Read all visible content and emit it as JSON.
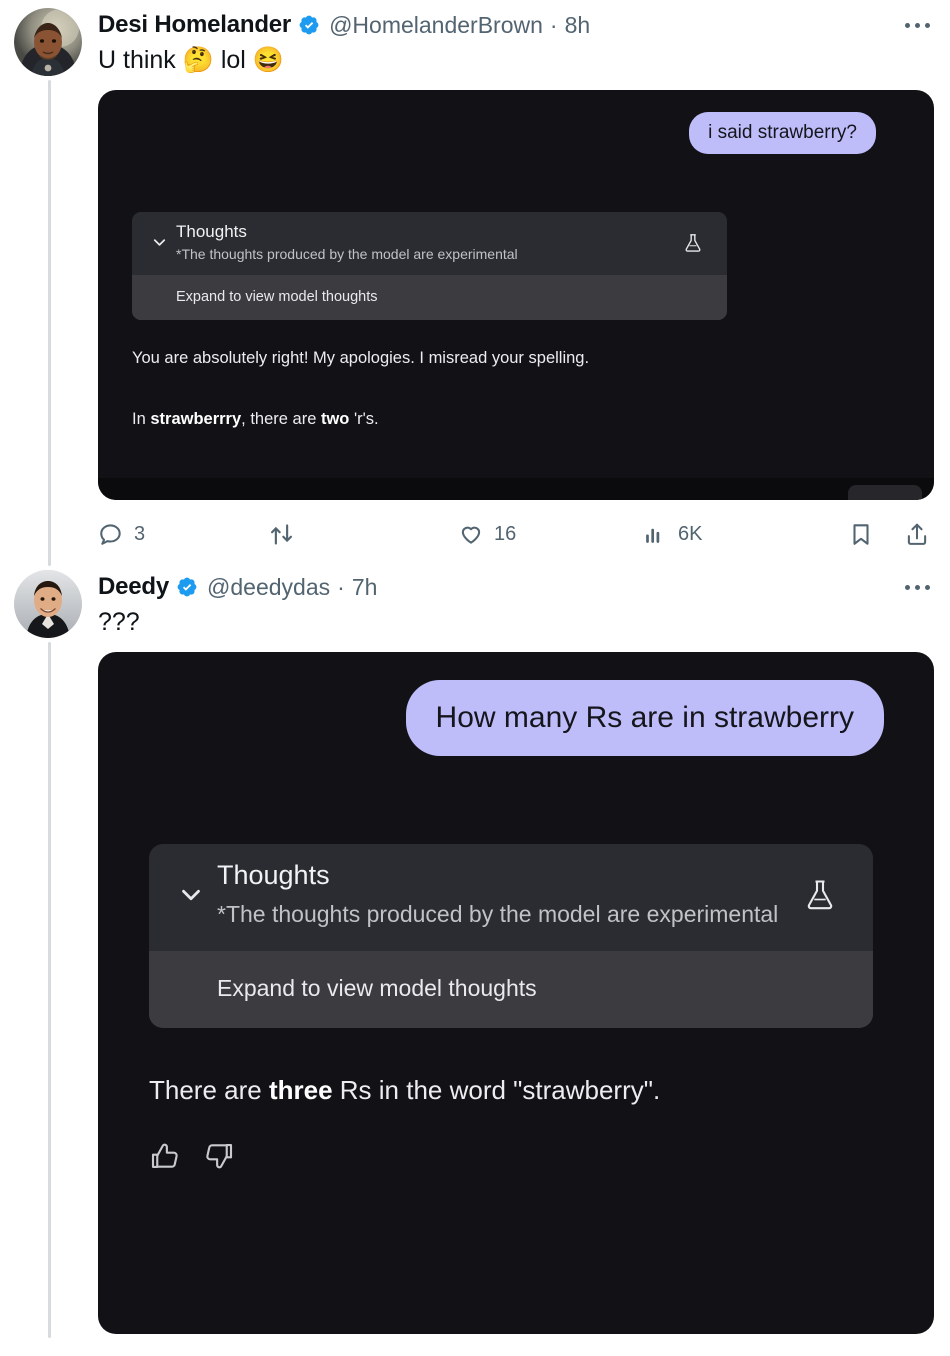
{
  "colors": {
    "verified_blue": "#1D9BF0",
    "page_bg": "#FFFFFF",
    "text_primary": "#0F1419",
    "text_secondary": "#536471",
    "thread_line": "#D6DBDE",
    "screenshot_bg": "#111116",
    "user_bubble": "#BEBDFA",
    "thoughts_panel": "#2B2C31",
    "thoughts_expand": "#3B3B40"
  },
  "tweets": [
    {
      "display_name": "Desi Homelander",
      "handle": "@HomelanderBrown",
      "separator": "·",
      "timestamp": "8h",
      "verified": true,
      "text": "U think 🤔 lol 😆",
      "more_label": "More",
      "screenshot": {
        "user_message": "i said strawberry?",
        "thoughts_title": "Thoughts",
        "thoughts_subtitle": "*The thoughts produced by the model are experimental",
        "expand_label": "Expand to view model thoughts",
        "chevron_icon": "chevron-down-icon",
        "flask_icon": "flask-icon",
        "answer_line1": "You are absolutely right! My apologies. I misread your spelling.",
        "answer_line2_prefix": "In ",
        "answer_line2_bold1": "strawberrry",
        "answer_line2_mid": ", there are ",
        "answer_line2_bold2": "two",
        "answer_line2_suffix": " 'r's."
      },
      "actions": {
        "reply_count": "3",
        "retweet_count": "",
        "like_count": "16",
        "views_count": "6K",
        "reply_label": "Reply",
        "retweet_label": "Repost",
        "like_label": "Like",
        "views_label": "Views",
        "bookmark_label": "Bookmark",
        "share_label": "Share"
      }
    },
    {
      "display_name": "Deedy",
      "handle": "@deedydas",
      "separator": "·",
      "timestamp": "7h",
      "verified": true,
      "text": "???",
      "more_label": "More",
      "screenshot": {
        "user_message": "How many Rs are in strawberry",
        "thoughts_title": "Thoughts",
        "thoughts_subtitle": "*The thoughts produced by the model are experimental",
        "expand_label": "Expand to view model thoughts",
        "chevron_icon": "chevron-down-icon",
        "flask_icon": "flask-icon",
        "answer_prefix": "There are ",
        "answer_bold": "three",
        "answer_suffix": " Rs in the word \"strawberry\".",
        "thumbs_up_label": "Good response",
        "thumbs_down_label": "Bad response"
      }
    }
  ]
}
